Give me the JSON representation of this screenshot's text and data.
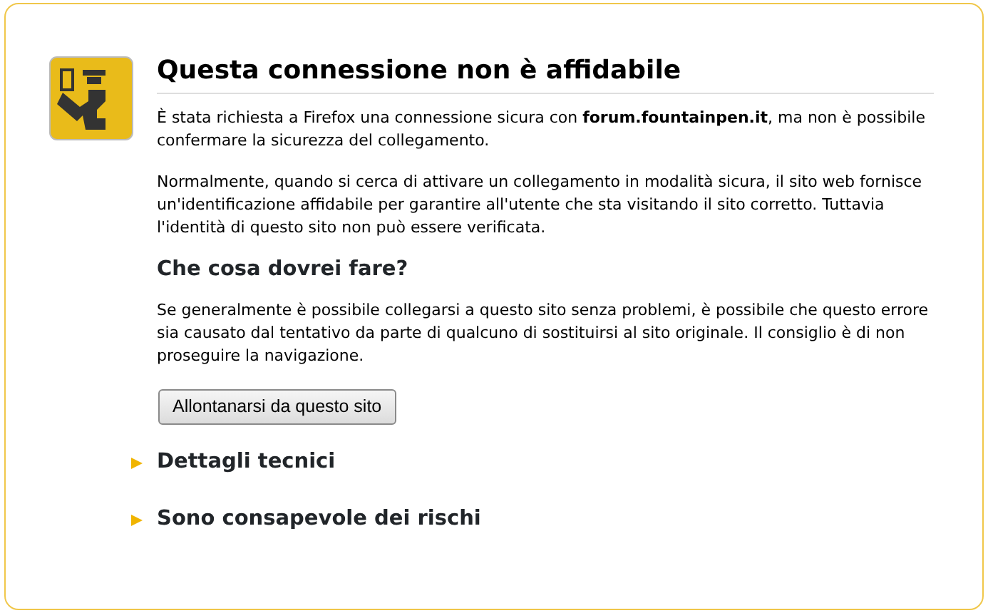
{
  "title": "Questa connessione non è affidabile",
  "paragraphs": [
    "È stata richiesta a Firefox una connessione sicura con **forum.fountainpen.it**, ma non è possibile confermare la sicurezza del collegamento.",
    "Normalmente, quando si cerca di attivare un collegamento in modalità sicura, il sito web fornisce un'identificazione affidabile per garantire all'utente che sta visitando il sito corretto. Tuttavia l'identità di questo sito non può essere verificata."
  ],
  "subheading": "Che cosa dovrei fare?",
  "advice": "Se generalmente è possibile collegarsi a questo sito senza problemi, è possibile che questo errore sia causato dal tentativo da parte di qualcuno di sostituirsi al sito originale. Il consiglio è di non proseguire la navigazione.",
  "button": "Allontanarsi da questo sito",
  "sections": [
    {
      "label": "Dettagli tecnici",
      "expanded": false
    },
    {
      "label": "Sono consapevole dei rischi",
      "expanded": false
    }
  ]
}
